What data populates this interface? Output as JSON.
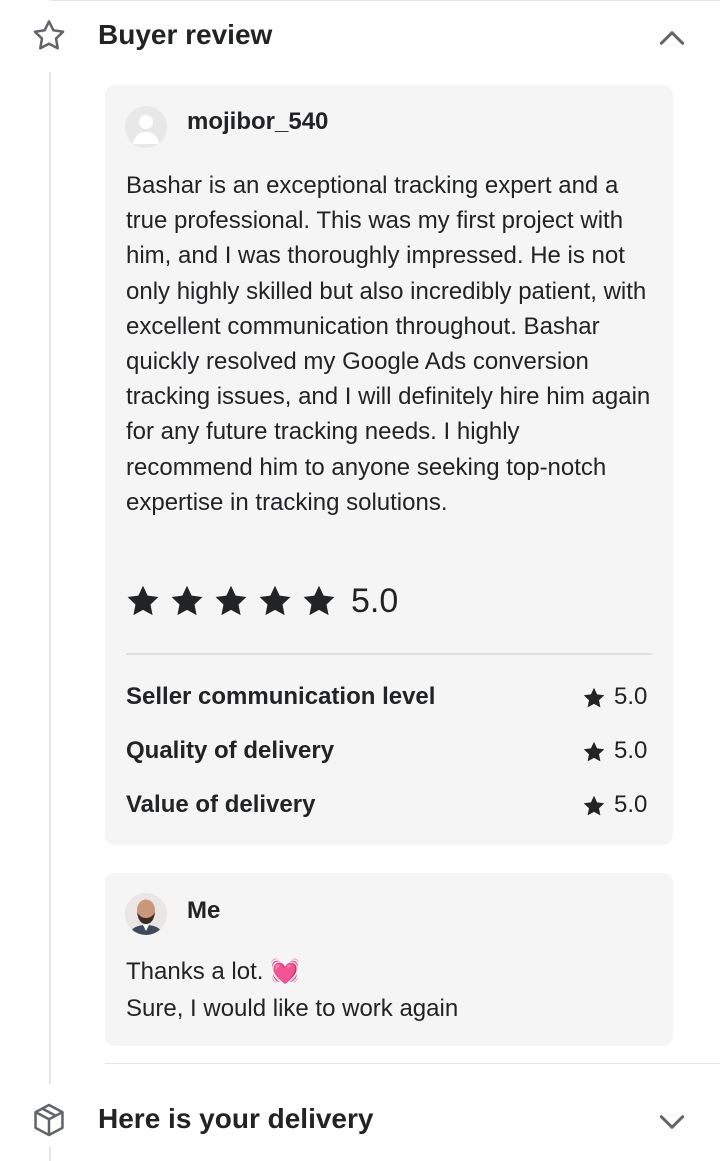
{
  "buyer_review": {
    "title": "Buyer review",
    "icon": "star-outline-icon",
    "expanded": true,
    "review": {
      "username": "mojibor_540",
      "text": "Bashar is an exceptional tracking expert and a true professional. This was my first project with him, and I was thoroughly impressed. He is not only highly skilled but also incredibly patient, with excellent communication throughout. Bashar quickly resolved my Google Ads conversion tracking issues, and I will definitely hire him again for any future tracking needs. I highly recommend him to anyone seeking top-notch expertise in tracking solutions.",
      "stars": 5,
      "overall_rating": "5.0",
      "sub_ratings": [
        {
          "label": "Seller communication level",
          "value": "5.0"
        },
        {
          "label": "Quality of delivery",
          "value": "5.0"
        },
        {
          "label": "Value of delivery",
          "value": "5.0"
        }
      ]
    },
    "reply": {
      "username": "Me",
      "line1": "Thanks a lot. 💓",
      "line2": "Sure, I would like to work again"
    }
  },
  "delivery_section": {
    "title": "Here is your delivery",
    "icon": "package-icon",
    "expanded": false
  },
  "colors": {
    "text": "#222325",
    "card_background": "#f5f5f5",
    "divider": "#e4e5e7"
  }
}
